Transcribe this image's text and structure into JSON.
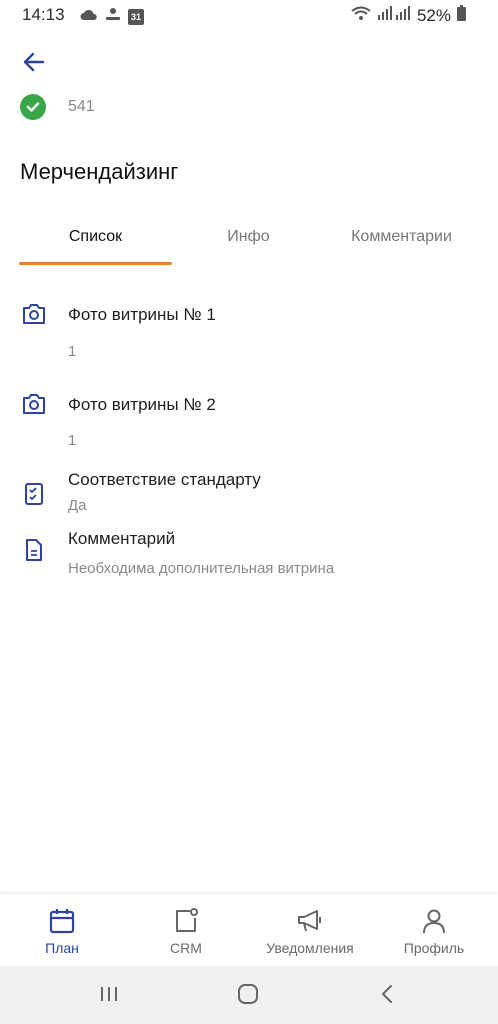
{
  "status_bar": {
    "time": "14:13",
    "calendar_day": "31",
    "battery_percent": "52%",
    "icons": [
      "cloud-icon",
      "weather-icon",
      "calendar-icon",
      "wifi-icon",
      "signal-icon",
      "battery-icon"
    ]
  },
  "header": {
    "back_icon": "arrow-left-icon",
    "status_icon": "check-circle-icon",
    "status_color": "#3aa64a",
    "number": "541",
    "title": "Мерчендайзинг"
  },
  "tabs": [
    {
      "label": "Список",
      "active": true
    },
    {
      "label": "Инфо",
      "active": false
    },
    {
      "label": "Комментарии",
      "active": false
    }
  ],
  "tab_indicator_color": "#f07f23",
  "fields": [
    {
      "icon": "camera-icon",
      "label": "Фото витрины № 1",
      "value": "1"
    },
    {
      "icon": "camera-icon",
      "label": "Фото витрины № 2",
      "value": "1"
    },
    {
      "icon": "checklist-icon",
      "label": "Соответствие стандарту",
      "value": "Да"
    },
    {
      "icon": "document-icon",
      "label": "Комментарий",
      "value": "Необходима дополнительная витрина"
    }
  ],
  "bottom_nav": [
    {
      "icon": "calendar-icon",
      "label": "План",
      "active": true
    },
    {
      "icon": "crm-icon",
      "label": "CRM",
      "active": false
    },
    {
      "icon": "megaphone-icon",
      "label": "Уведомления",
      "active": false
    },
    {
      "icon": "person-icon",
      "label": "Профиль",
      "active": false
    }
  ],
  "accent_color": "#2d44a0",
  "system_nav": [
    "recents-icon",
    "home-icon",
    "back-icon"
  ]
}
